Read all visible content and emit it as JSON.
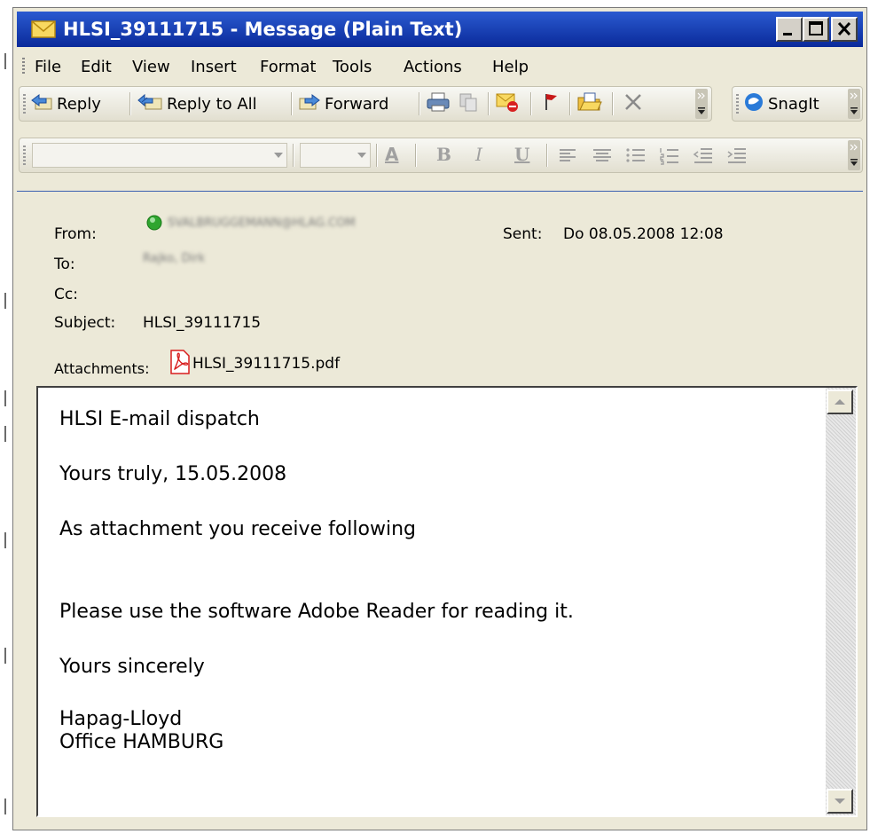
{
  "window": {
    "title": "HLSI_39111715 - Message (Plain Text)"
  },
  "menu": [
    {
      "label": "File"
    },
    {
      "label": "Edit"
    },
    {
      "label": "View"
    },
    {
      "label": "Insert"
    },
    {
      "label": "Format"
    },
    {
      "label": "Tools"
    },
    {
      "label": "Actions"
    },
    {
      "label": "Help"
    }
  ],
  "toolbar": {
    "reply": "Reply",
    "reply_all": "Reply to All",
    "forward": "Forward",
    "snagit": "SnagIt"
  },
  "header": {
    "from_label": "From:",
    "from_value": "SVALBRUGGEMANN@HLAG.COM",
    "sent_label": "Sent:",
    "sent_value": "Do 08.05.2008 12:08",
    "to_label": "To:",
    "to_value": "Rajko, Dirk",
    "cc_label": "Cc:",
    "cc_value": "",
    "subject_label": "Subject:",
    "subject_value": "HLSI_39111715",
    "attachments_label": "Attachments:",
    "attachment_file": "HLSI_39111715.pdf"
  },
  "body": {
    "line1": "HLSI E-mail dispatch",
    "line2": "Yours truly, 15.05.2008",
    "line3": "As attachment you receive following",
    "line4": "Please use the software Adobe Reader for reading it.",
    "line5": "Yours sincerely",
    "line6": "Hapag-Lloyd",
    "line7": "Office HAMBURG"
  },
  "colors": {
    "title_bar": "#0a2a9a",
    "presence": "#2fa52f",
    "pdf_icon": "#d81e1e"
  },
  "icons": {
    "title": "envelope-icon",
    "reply": "reply-icon",
    "reply_all": "reply-all-icon",
    "forward": "forward-icon",
    "print": "printer-icon",
    "copy": "copy-icon",
    "move": "move-to-folder-icon",
    "flag": "flag-icon",
    "open": "open-folder-icon",
    "delete": "delete-icon",
    "snagit": "snagit-icon",
    "attachment": "pdf-icon",
    "presence": "presence-icon"
  }
}
